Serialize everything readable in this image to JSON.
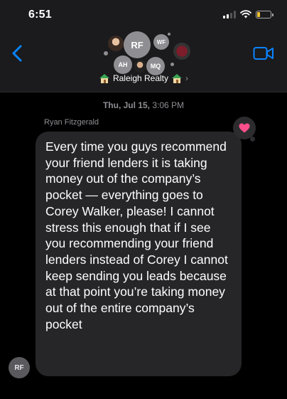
{
  "status_bar": {
    "time": "6:51",
    "signal_icon": "cellular-signal-icon",
    "wifi_icon": "wifi-icon",
    "battery_icon": "battery-low-icon",
    "battery_color": "#f2c230"
  },
  "header": {
    "back_icon": "chevron-left-icon",
    "video_icon": "video-camera-icon",
    "accent_color": "#0a84ff",
    "group_name": "Raleigh Realty",
    "group_chevron": "›",
    "participants": [
      "RF",
      "WF",
      "AH",
      "MQ"
    ]
  },
  "conversation": {
    "timestamp_day": "Thu, Jul 15,",
    "timestamp_time": "3:06 PM",
    "sender_name": "Ryan Fitzgerald",
    "sender_initials": "RF",
    "reaction": "heart",
    "reaction_color": "#ff4f8b",
    "message": "Every time you guys recommend your friend lenders it is taking money out of the company’s pocket — everything goes to Corey Walker, please! I cannot stress this enough that if I see you recommending your friend lenders instead of Corey I cannot keep sending you leads because at that point you’re taking money out of the entire company’s pocket"
  }
}
